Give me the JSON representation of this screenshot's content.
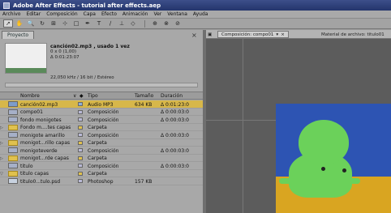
{
  "window": {
    "title": "Adobe After Effects - tutorial after effects.aep"
  },
  "menubar": {
    "items": [
      "Archivo",
      "Editar",
      "Composición",
      "Capa",
      "Efecto",
      "Animación",
      "Ver",
      "Ventana",
      "Ayuda"
    ]
  },
  "toolbar": {
    "tools": [
      "selection-tool",
      "hand-tool",
      "zoom-tool",
      "rotate-tool",
      "camera-tool",
      "pan-behind-tool",
      "mask-tool",
      "pen-tool",
      "text-tool",
      "brush-tool",
      "clone-stamp-tool",
      "eraser-tool"
    ]
  },
  "project": {
    "tab_label": "Proyecto",
    "selected_name": "canción02.mp3 , usado 1 vez",
    "info_dims": "0 x 0 (1,00)",
    "info_duration": "Δ 0:01:23:07",
    "audio_info": "22,050 kHz / 16 bit / Estéreo",
    "columns": {
      "name": "Nombre",
      "type": "Tipo",
      "size": "Tamaño",
      "duration": "Duración"
    },
    "rows": [
      {
        "name": "canción02.mp3",
        "icon": "audio",
        "type": "Audio MP3",
        "size": "634 KB",
        "duration": "Δ 0:01:23:0",
        "selected": true,
        "expander": ""
      },
      {
        "name": "compo01",
        "icon": "comp",
        "type": "Composición",
        "size": "",
        "duration": "Δ 0:00:03:0",
        "selected": false,
        "expander": ""
      },
      {
        "name": "fondo monigotes",
        "icon": "comp",
        "type": "Composición",
        "size": "",
        "duration": "Δ 0:00:03:0",
        "selected": false,
        "expander": ""
      },
      {
        "name": "Fondo m....tes capas",
        "icon": "folder",
        "type": "Carpeta",
        "size": "",
        "duration": "",
        "selected": false,
        "expander": "▷"
      },
      {
        "name": "monigote amarillo",
        "icon": "comp",
        "type": "Composición",
        "size": "",
        "duration": "Δ 0:00:03:0",
        "selected": false,
        "expander": ""
      },
      {
        "name": "monigot...rillo capas",
        "icon": "folder",
        "type": "Carpeta",
        "size": "",
        "duration": "",
        "selected": false,
        "expander": "▷"
      },
      {
        "name": "monigoteverde",
        "icon": "comp",
        "type": "Composición",
        "size": "",
        "duration": "Δ 0:00:03:0",
        "selected": false,
        "expander": ""
      },
      {
        "name": "monigot...rde capas",
        "icon": "folder",
        "type": "Carpeta",
        "size": "",
        "duration": "",
        "selected": false,
        "expander": "▷"
      },
      {
        "name": "titulo",
        "icon": "comp",
        "type": "Composición",
        "size": "",
        "duration": "Δ 0:00:03:0",
        "selected": false,
        "expander": ""
      },
      {
        "name": "titulo capas",
        "icon": "folder",
        "type": "Carpeta",
        "size": "",
        "duration": "",
        "selected": false,
        "expander": "▽"
      },
      {
        "name": "titulo0...tulo.psd",
        "icon": "psd",
        "type": "Photoshop",
        "size": "157 KB",
        "duration": "",
        "selected": false,
        "expander": ""
      }
    ]
  },
  "viewer": {
    "tab_comp_label": "Composición: compo01",
    "tab_footage_label": "Material de archivo: titulo01"
  },
  "colors": {
    "selection": "#d7b74a",
    "sky": "#2d54b3",
    "ground": "#d9a521",
    "character": "#6bd15a",
    "titlebar": "#24356c"
  }
}
